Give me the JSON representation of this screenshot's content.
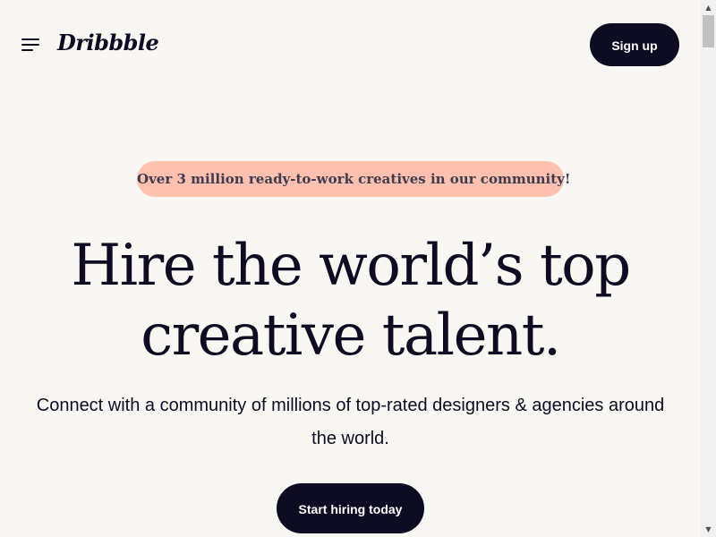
{
  "header": {
    "logo_text": "Dribbble",
    "menu_icon": "hamburger-menu-icon",
    "signup_label": "Sign up"
  },
  "hero": {
    "badge_text": "Over 3 million ready-to-work creatives in our community!",
    "headline_line1": "Hire the world’s top",
    "headline_line2": "creative talent.",
    "subtext": "Connect with a community of millions of top-rated designers & agencies around the world.",
    "cta_label": "Start hiring today"
  },
  "colors": {
    "background": "#f8f7f4",
    "primary_dark": "#0d0c22",
    "badge_bg": "#ffc0b0",
    "badge_text": "#3d3d4e"
  }
}
